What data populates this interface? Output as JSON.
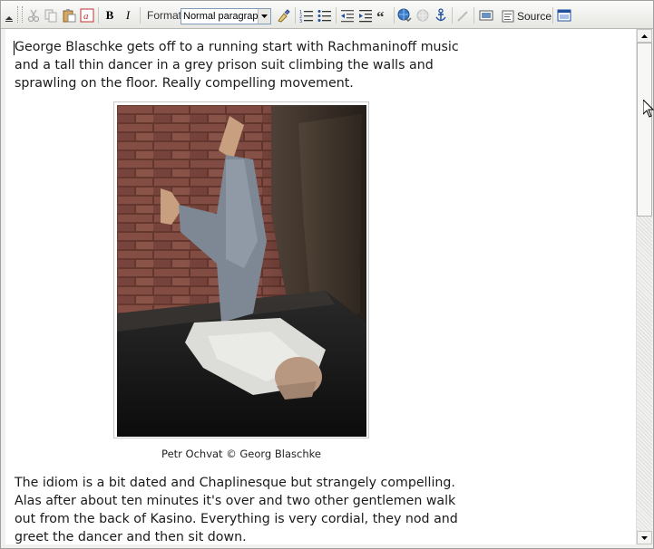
{
  "toolbar": {
    "format_label": "Format",
    "format_value": "Normal paragraph",
    "source_label": "Source",
    "bold_glyph": "B",
    "italic_glyph": "I",
    "icons": [
      "collapse-icon",
      "cut-icon",
      "copy-icon",
      "paste-icon",
      "paste-word-icon",
      "bold-icon",
      "italic-icon",
      "format-dropdown",
      "remove-format-icon",
      "numbered-list-icon",
      "bullet-list-icon",
      "outdent-icon",
      "indent-icon",
      "blockquote-icon",
      "link-icon",
      "unlink-icon",
      "anchor-icon",
      "image-edit-icon",
      "image-icon",
      "source-icon",
      "maximize-icon"
    ]
  },
  "content": {
    "paragraph1": "George Blaschke gets off to a running start with Rachmaninoff music and a tall thin dancer in a grey prison suit climbing the walls and sprawling on the floor. Really compelling movement.",
    "image_caption": "Petr Ochvat © Georg Blaschke",
    "paragraph2": "The idiom is a bit dated and Chaplinesque but strangely compelling. Alas after about ten minutes it's over and two other gentlemen walk out from the back of Kasino. Everything is very cordial, they nod and greet the dancer and then sit down."
  }
}
